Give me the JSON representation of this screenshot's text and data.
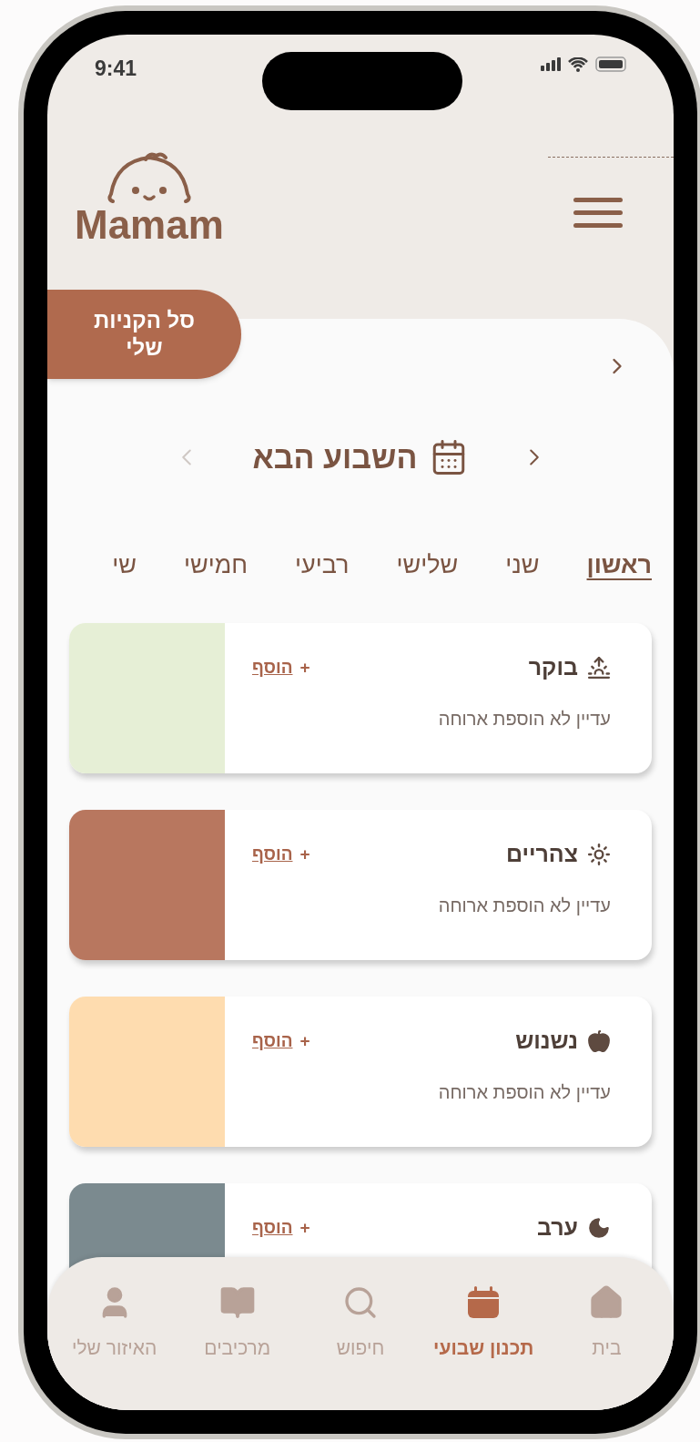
{
  "status_bar": {
    "time": "9:41"
  },
  "header": {
    "logo_text": "Mamam"
  },
  "shopping_basket": {
    "label": "סל הקניות שלי"
  },
  "week_nav": {
    "title": "השבוע הבא",
    "prev_disabled": false,
    "next_disabled": true
  },
  "day_tabs": [
    {
      "label": "ראשון",
      "selected": true
    },
    {
      "label": "שני",
      "selected": false
    },
    {
      "label": "שלישי",
      "selected": false
    },
    {
      "label": "רביעי",
      "selected": false
    },
    {
      "label": "חמישי",
      "selected": false
    },
    {
      "label": "שי",
      "selected": false
    }
  ],
  "meals": [
    {
      "title": "בוקר",
      "add_label": "הוסף",
      "plus": "+",
      "subtitle": "עדיין לא הוספת ארוחה",
      "color": "#e6efd6"
    },
    {
      "title": "צהריים",
      "add_label": "הוסף",
      "plus": "+",
      "subtitle": "עדיין לא הוספת ארוחה",
      "color": "#b8775f"
    },
    {
      "title": "נשנוש",
      "add_label": "הוסף",
      "plus": "+",
      "subtitle": "עדיין לא הוספת ארוחה",
      "color": "#fedcaf"
    },
    {
      "title": "ערב",
      "add_label": "הוסף",
      "plus": "+",
      "color": "#7b8a8f"
    }
  ],
  "bottom_nav": [
    {
      "label": "בית",
      "selected": false
    },
    {
      "label": "תכנון שבועי",
      "selected": true
    },
    {
      "label": "חיפוש",
      "selected": false
    },
    {
      "label": "מרכיבים",
      "selected": false
    },
    {
      "label": "האיזור שלי",
      "selected": false
    }
  ]
}
